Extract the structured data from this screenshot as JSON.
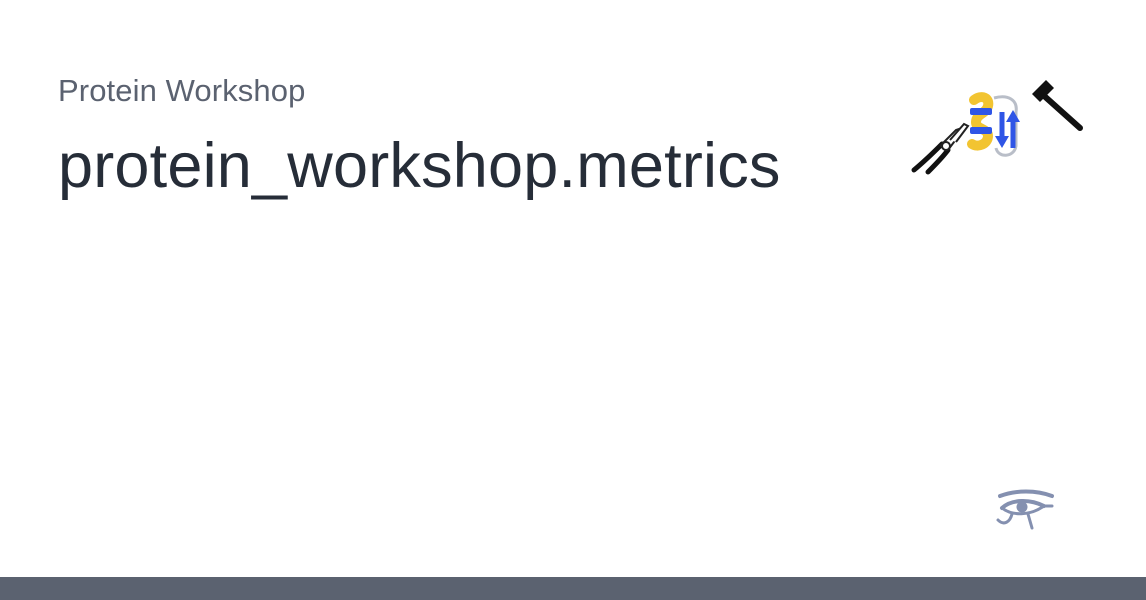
{
  "card": {
    "site_name": "Protein Workshop",
    "page_title": "protein_workshop.metrics"
  },
  "logo": {
    "icons": [
      "pliers-icon",
      "protein-structure-icon",
      "hammer-icon"
    ]
  },
  "footer": {
    "mark_icon": "eye-of-horus-icon"
  },
  "colors": {
    "site_name": "#5b6270",
    "page_title": "#262d38",
    "footer_bar": "#5b6270",
    "helix_yellow": "#f2c431",
    "strand_blue": "#2f55e6",
    "loop_gray": "#b9bec8",
    "eye_mark": "#8490b0"
  }
}
